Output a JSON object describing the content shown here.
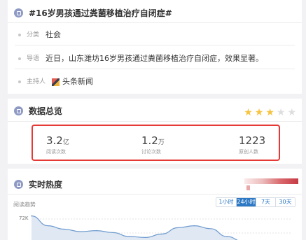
{
  "topic": {
    "title": "#16岁男孩通过粪菌移植治疗自闭症#",
    "category_label": "分类",
    "category_value": "社会",
    "lead_label": "导语",
    "lead_value": "近日，山东潍坊16岁男孩通过粪菌移植治疗自闭症，效果显著。",
    "host_label": "主持人",
    "host_value": "头条新闻"
  },
  "overview": {
    "title": "数据总览",
    "rating": 3,
    "rating_max": 5,
    "stats": [
      {
        "value": "3.2",
        "unit": "亿",
        "caption": "阅读次数"
      },
      {
        "value": "1.2",
        "unit": "万",
        "caption": "讨论次数"
      },
      {
        "value": "1223",
        "unit": "",
        "caption": "原创人数"
      }
    ]
  },
  "heat": {
    "title": "实时热度",
    "trend_label": "阅读趋势",
    "range_tabs": [
      "1小时",
      "24小时",
      "7天",
      "30天"
    ],
    "active_range": "24小时",
    "y_tick": "72K"
  },
  "chart_data": {
    "type": "area",
    "series": [
      {
        "values": [
          72,
          52,
          45,
          40,
          42,
          38,
          30,
          28,
          35,
          48,
          52,
          46,
          30,
          20,
          12,
          8,
          5
        ]
      }
    ],
    "ylim": [
      0,
      80
    ],
    "y_ticks": [
      "72K"
    ]
  }
}
